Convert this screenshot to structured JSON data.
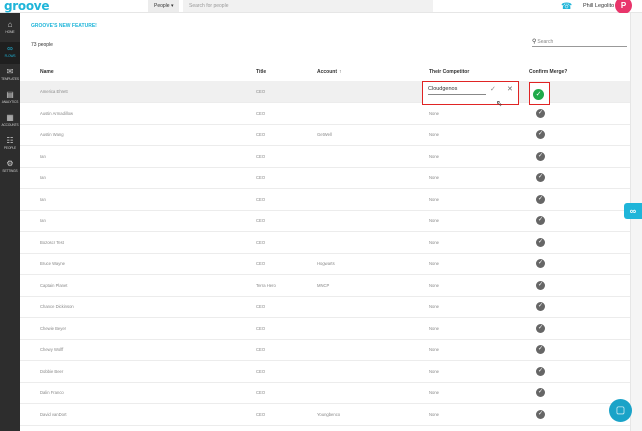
{
  "app": {
    "logo": "groove",
    "people_dropdown": "People ▾",
    "search_placeholder": "Search for people",
    "user_name": "Phill Legolito",
    "avatar_initial": "P",
    "phone_icon": "phone-icon"
  },
  "sidebar": {
    "items": [
      {
        "icon": "⌂",
        "label": "Home"
      },
      {
        "icon": "∞",
        "label": "Flows"
      },
      {
        "icon": "✉",
        "label": "Templates"
      },
      {
        "icon": "▤",
        "label": "Analytics"
      },
      {
        "icon": "▦",
        "label": "Accounts"
      },
      {
        "icon": "☷",
        "label": "People"
      },
      {
        "icon": "⚙",
        "label": "Settings"
      }
    ]
  },
  "main": {
    "feature_title": "GROOVE'S NEW FEATURE!",
    "count": "73 people",
    "search_placeholder": "Search",
    "columns": {
      "name": "Name",
      "title": "Title",
      "account": "Account",
      "account_sort": "↑",
      "competitor": "Their Competitor",
      "confirm": "Confirm Merge?"
    },
    "edit": {
      "value": "Cloudgenos",
      "ok": "✓",
      "cancel": "✕"
    },
    "rows": [
      {
        "name": "America Ehrett",
        "title": "CEO",
        "account": "",
        "competitor": ""
      },
      {
        "name": "Austin Armadillow",
        "title": "CEO",
        "account": "",
        "competitor": "None"
      },
      {
        "name": "Austin Wang",
        "title": "CEO",
        "account": "GetWell",
        "competitor": "None"
      },
      {
        "name": "Ian",
        "title": "CEO",
        "account": "",
        "competitor": "None"
      },
      {
        "name": "Ian",
        "title": "CEO",
        "account": "",
        "competitor": "None"
      },
      {
        "name": "Ian",
        "title": "CEO",
        "account": "",
        "competitor": "None"
      },
      {
        "name": "Ian",
        "title": "CEO",
        "account": "",
        "competitor": "None"
      },
      {
        "name": "Bozoscr Test",
        "title": "CEO",
        "account": "",
        "competitor": "None"
      },
      {
        "name": "Bruce Wayne",
        "title": "CEO",
        "account": "Hogwarts",
        "competitor": "None"
      },
      {
        "name": "Captain Planet",
        "title": "Terra Hero",
        "account": "MNCP",
        "competitor": "None"
      },
      {
        "name": "Chance Dickinson",
        "title": "CEO",
        "account": "",
        "competitor": "None"
      },
      {
        "name": "Chewie Beyer",
        "title": "CEO",
        "account": "",
        "competitor": "None"
      },
      {
        "name": "Chewy Wolff",
        "title": "CEO",
        "account": "",
        "competitor": "None"
      },
      {
        "name": "Dobbie Beer",
        "title": "CEO",
        "account": "",
        "competitor": "None"
      },
      {
        "name": "Dalin Franco",
        "title": "CEO",
        "account": "",
        "competitor": "None"
      },
      {
        "name": "David vanDort",
        "title": "CEO",
        "account": "Youngbenco",
        "competitor": "None"
      }
    ]
  },
  "colors": {
    "accent": "#1fb5d9",
    "sidebar": "#2d2d2d",
    "highlight_border": "#e02424",
    "confirm_green": "#1faa4a"
  },
  "widgets": {
    "side_tab_icon": "∞",
    "chat_icon": "▢"
  }
}
